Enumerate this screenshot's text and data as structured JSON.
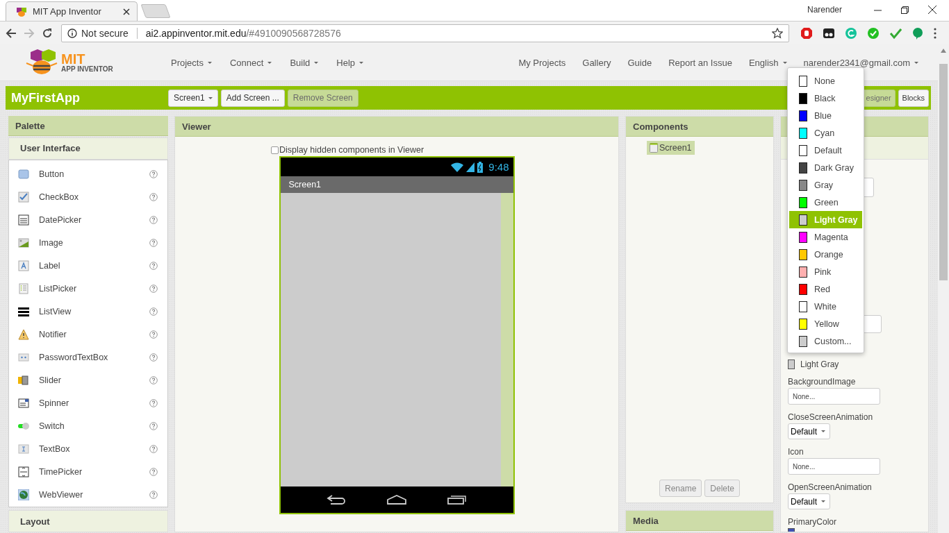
{
  "browser": {
    "tab_title": "MIT App Inventor",
    "profile": "Narender",
    "security": "Not secure",
    "url_host": "ai2.appinventor.mit.edu",
    "url_path": "/#4910090568728576"
  },
  "header": {
    "logo_top": "MIT",
    "logo_bottom": "APP INVENTOR",
    "menus": [
      {
        "label": "Projects"
      },
      {
        "label": "Connect"
      },
      {
        "label": "Build"
      },
      {
        "label": "Help"
      }
    ],
    "links": [
      "My Projects",
      "Gallery",
      "Guide",
      "Report an Issue"
    ],
    "language": "English",
    "account": "narender2341@gmail.com"
  },
  "project_bar": {
    "title": "MyFirstApp",
    "buttons": [
      {
        "label": "Screen1",
        "kind": "dropdown",
        "disabled": false
      },
      {
        "label": "Add Screen ...",
        "kind": "plain",
        "disabled": false
      },
      {
        "label": "Remove Screen",
        "kind": "plain",
        "disabled": true
      }
    ],
    "right_buttons": [
      {
        "label": "esigner",
        "disabled": true
      },
      {
        "label": "Blocks",
        "disabled": false
      }
    ]
  },
  "palette": {
    "title": "Palette",
    "category": "User Interface",
    "items": [
      {
        "label": "Button",
        "kind": "button"
      },
      {
        "label": "CheckBox",
        "kind": "checkbox"
      },
      {
        "label": "DatePicker",
        "kind": "datepicker"
      },
      {
        "label": "Image",
        "kind": "image"
      },
      {
        "label": "Label",
        "kind": "label"
      },
      {
        "label": "ListPicker",
        "kind": "listpicker"
      },
      {
        "label": "ListView",
        "kind": "listview"
      },
      {
        "label": "Notifier",
        "kind": "notifier"
      },
      {
        "label": "PasswordTextBox",
        "kind": "password"
      },
      {
        "label": "Slider",
        "kind": "slider"
      },
      {
        "label": "Spinner",
        "kind": "spinner"
      },
      {
        "label": "Switch",
        "kind": "switch"
      },
      {
        "label": "TextBox",
        "kind": "textbox"
      },
      {
        "label": "TimePicker",
        "kind": "timepicker"
      },
      {
        "label": "WebViewer",
        "kind": "webviewer"
      }
    ],
    "next_category": "Layout"
  },
  "viewer": {
    "title": "Viewer",
    "hidden_checkbox": {
      "label": "Display hidden components in Viewer",
      "checked": false
    },
    "phone": {
      "time": "9:48",
      "screen_title": "Screen1"
    }
  },
  "components": {
    "title": "Components",
    "tree": [
      {
        "label": "Screen1",
        "selected": true
      }
    ],
    "buttons": [
      {
        "label": "Rename",
        "disabled": true
      },
      {
        "label": "Delete",
        "disabled": true
      }
    ],
    "media_title": "Media"
  },
  "properties": {
    "fields": [
      {
        "kind": "textarea"
      },
      {
        "kind": "textbox"
      },
      {
        "kind": "color",
        "value": "Light Gray",
        "color": "#cccccc"
      },
      {
        "kind": "file",
        "label": "BackgroundImage",
        "value": "None..."
      },
      {
        "kind": "dropdown",
        "label": "CloseScreenAnimation",
        "value": "Default"
      },
      {
        "kind": "file",
        "label": "Icon",
        "value": "None..."
      },
      {
        "kind": "dropdown",
        "label": "OpenScreenAnimation",
        "value": "Default"
      },
      {
        "kind": "color",
        "label": "PrimaryColor",
        "color": "#3f51b5"
      }
    ]
  },
  "color_menu": [
    {
      "label": "None",
      "color": "#ffffff",
      "selected": false
    },
    {
      "label": "Black",
      "color": "#000000",
      "selected": false
    },
    {
      "label": "Blue",
      "color": "#0000ff",
      "selected": false
    },
    {
      "label": "Cyan",
      "color": "#00ffff",
      "selected": false
    },
    {
      "label": "Default",
      "color": "#ffffff",
      "selected": false
    },
    {
      "label": "Dark Gray",
      "color": "#444444",
      "selected": false
    },
    {
      "label": "Gray",
      "color": "#888888",
      "selected": false
    },
    {
      "label": "Green",
      "color": "#00ff00",
      "selected": false
    },
    {
      "label": "Light Gray",
      "color": "#cccccc",
      "selected": true
    },
    {
      "label": "Magenta",
      "color": "#ff00ff",
      "selected": false
    },
    {
      "label": "Orange",
      "color": "#ffc800",
      "selected": false
    },
    {
      "label": "Pink",
      "color": "#ffafaf",
      "selected": false
    },
    {
      "label": "Red",
      "color": "#ff0000",
      "selected": false
    },
    {
      "label": "White",
      "color": "#ffffff",
      "selected": false
    },
    {
      "label": "Yellow",
      "color": "#ffff00",
      "selected": false
    },
    {
      "label": "Custom...",
      "color": "#cccccc",
      "selected": false
    }
  ]
}
